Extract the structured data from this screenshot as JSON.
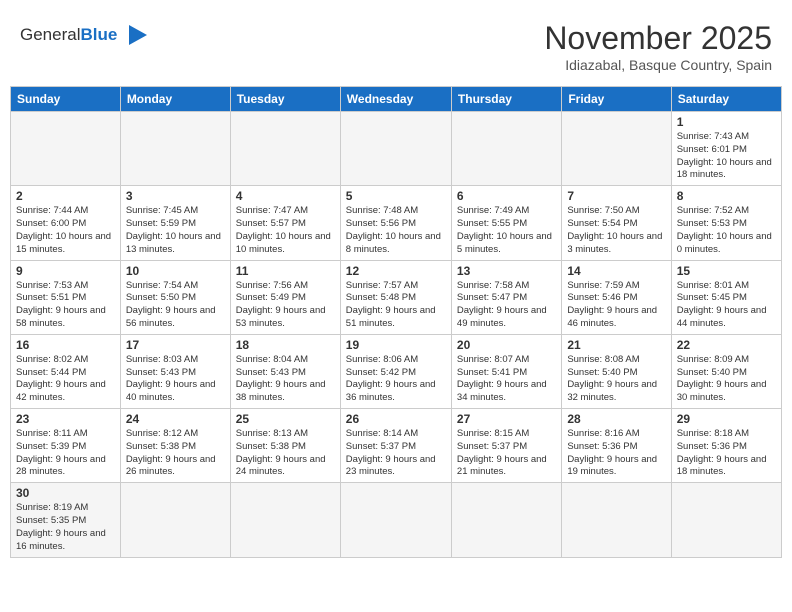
{
  "header": {
    "logo_line1": "General",
    "logo_line2": "Blue",
    "month": "November 2025",
    "location": "Idiazabal, Basque Country, Spain"
  },
  "weekdays": [
    "Sunday",
    "Monday",
    "Tuesday",
    "Wednesday",
    "Thursday",
    "Friday",
    "Saturday"
  ],
  "weeks": [
    [
      {
        "day": "",
        "info": ""
      },
      {
        "day": "",
        "info": ""
      },
      {
        "day": "",
        "info": ""
      },
      {
        "day": "",
        "info": ""
      },
      {
        "day": "",
        "info": ""
      },
      {
        "day": "",
        "info": ""
      },
      {
        "day": "1",
        "info": "Sunrise: 7:43 AM\nSunset: 6:01 PM\nDaylight: 10 hours and 18 minutes."
      }
    ],
    [
      {
        "day": "2",
        "info": "Sunrise: 7:44 AM\nSunset: 6:00 PM\nDaylight: 10 hours and 15 minutes."
      },
      {
        "day": "3",
        "info": "Sunrise: 7:45 AM\nSunset: 5:59 PM\nDaylight: 10 hours and 13 minutes."
      },
      {
        "day": "4",
        "info": "Sunrise: 7:47 AM\nSunset: 5:57 PM\nDaylight: 10 hours and 10 minutes."
      },
      {
        "day": "5",
        "info": "Sunrise: 7:48 AM\nSunset: 5:56 PM\nDaylight: 10 hours and 8 minutes."
      },
      {
        "day": "6",
        "info": "Sunrise: 7:49 AM\nSunset: 5:55 PM\nDaylight: 10 hours and 5 minutes."
      },
      {
        "day": "7",
        "info": "Sunrise: 7:50 AM\nSunset: 5:54 PM\nDaylight: 10 hours and 3 minutes."
      },
      {
        "day": "8",
        "info": "Sunrise: 7:52 AM\nSunset: 5:53 PM\nDaylight: 10 hours and 0 minutes."
      }
    ],
    [
      {
        "day": "9",
        "info": "Sunrise: 7:53 AM\nSunset: 5:51 PM\nDaylight: 9 hours and 58 minutes."
      },
      {
        "day": "10",
        "info": "Sunrise: 7:54 AM\nSunset: 5:50 PM\nDaylight: 9 hours and 56 minutes."
      },
      {
        "day": "11",
        "info": "Sunrise: 7:56 AM\nSunset: 5:49 PM\nDaylight: 9 hours and 53 minutes."
      },
      {
        "day": "12",
        "info": "Sunrise: 7:57 AM\nSunset: 5:48 PM\nDaylight: 9 hours and 51 minutes."
      },
      {
        "day": "13",
        "info": "Sunrise: 7:58 AM\nSunset: 5:47 PM\nDaylight: 9 hours and 49 minutes."
      },
      {
        "day": "14",
        "info": "Sunrise: 7:59 AM\nSunset: 5:46 PM\nDaylight: 9 hours and 46 minutes."
      },
      {
        "day": "15",
        "info": "Sunrise: 8:01 AM\nSunset: 5:45 PM\nDaylight: 9 hours and 44 minutes."
      }
    ],
    [
      {
        "day": "16",
        "info": "Sunrise: 8:02 AM\nSunset: 5:44 PM\nDaylight: 9 hours and 42 minutes."
      },
      {
        "day": "17",
        "info": "Sunrise: 8:03 AM\nSunset: 5:43 PM\nDaylight: 9 hours and 40 minutes."
      },
      {
        "day": "18",
        "info": "Sunrise: 8:04 AM\nSunset: 5:43 PM\nDaylight: 9 hours and 38 minutes."
      },
      {
        "day": "19",
        "info": "Sunrise: 8:06 AM\nSunset: 5:42 PM\nDaylight: 9 hours and 36 minutes."
      },
      {
        "day": "20",
        "info": "Sunrise: 8:07 AM\nSunset: 5:41 PM\nDaylight: 9 hours and 34 minutes."
      },
      {
        "day": "21",
        "info": "Sunrise: 8:08 AM\nSunset: 5:40 PM\nDaylight: 9 hours and 32 minutes."
      },
      {
        "day": "22",
        "info": "Sunrise: 8:09 AM\nSunset: 5:40 PM\nDaylight: 9 hours and 30 minutes."
      }
    ],
    [
      {
        "day": "23",
        "info": "Sunrise: 8:11 AM\nSunset: 5:39 PM\nDaylight: 9 hours and 28 minutes."
      },
      {
        "day": "24",
        "info": "Sunrise: 8:12 AM\nSunset: 5:38 PM\nDaylight: 9 hours and 26 minutes."
      },
      {
        "day": "25",
        "info": "Sunrise: 8:13 AM\nSunset: 5:38 PM\nDaylight: 9 hours and 24 minutes."
      },
      {
        "day": "26",
        "info": "Sunrise: 8:14 AM\nSunset: 5:37 PM\nDaylight: 9 hours and 23 minutes."
      },
      {
        "day": "27",
        "info": "Sunrise: 8:15 AM\nSunset: 5:37 PM\nDaylight: 9 hours and 21 minutes."
      },
      {
        "day": "28",
        "info": "Sunrise: 8:16 AM\nSunset: 5:36 PM\nDaylight: 9 hours and 19 minutes."
      },
      {
        "day": "29",
        "info": "Sunrise: 8:18 AM\nSunset: 5:36 PM\nDaylight: 9 hours and 18 minutes."
      }
    ],
    [
      {
        "day": "30",
        "info": "Sunrise: 8:19 AM\nSunset: 5:35 PM\nDaylight: 9 hours and 16 minutes."
      },
      {
        "day": "",
        "info": ""
      },
      {
        "day": "",
        "info": ""
      },
      {
        "day": "",
        "info": ""
      },
      {
        "day": "",
        "info": ""
      },
      {
        "day": "",
        "info": ""
      },
      {
        "day": "",
        "info": ""
      }
    ]
  ]
}
